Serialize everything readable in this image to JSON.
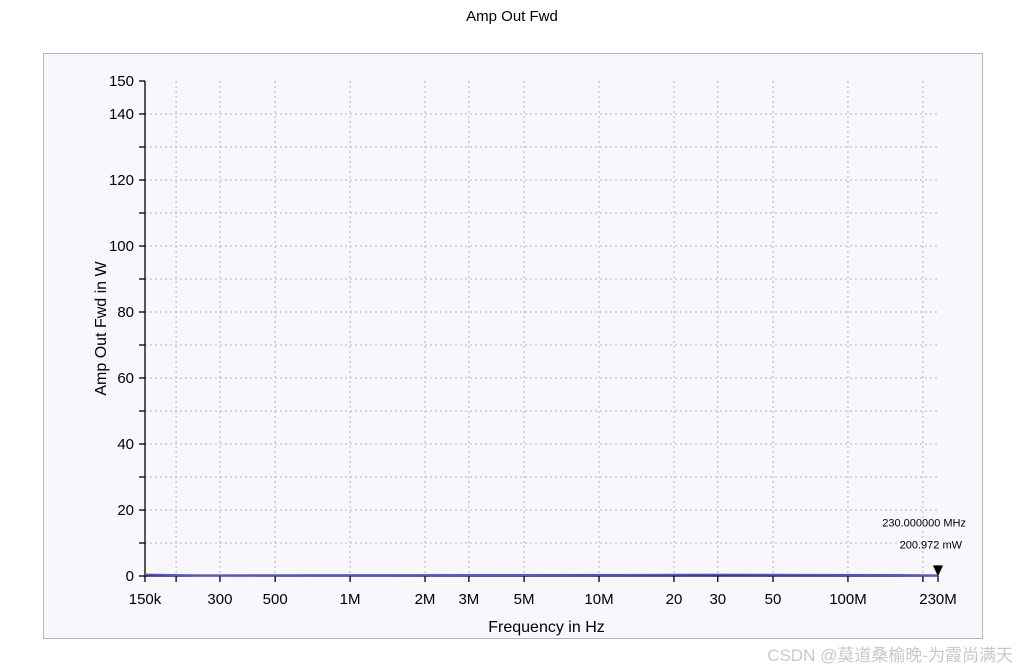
{
  "chart_data": {
    "type": "line",
    "title": "Amp Out Fwd",
    "xlabel": "Frequency in Hz",
    "ylabel": "Amp Out Fwd in W",
    "x_scale": "log",
    "xlim": [
      150000,
      230000000
    ],
    "ylim": [
      0,
      150
    ],
    "x_ticks": [
      {
        "value": 150000,
        "label": "150k"
      },
      {
        "value": 300000,
        "label": "300"
      },
      {
        "value": 500000,
        "label": "500"
      },
      {
        "value": 1000000,
        "label": "1M"
      },
      {
        "value": 2000000,
        "label": "2M"
      },
      {
        "value": 3000000,
        "label": "3M"
      },
      {
        "value": 5000000,
        "label": "5M"
      },
      {
        "value": 10000000,
        "label": "10M"
      },
      {
        "value": 20000000,
        "label": "20"
      },
      {
        "value": 30000000,
        "label": "30"
      },
      {
        "value": 50000000,
        "label": "50"
      },
      {
        "value": 100000000,
        "label": "100M"
      },
      {
        "value": 230000000,
        "label": "230M"
      }
    ],
    "x_grid": [
      150000,
      200000,
      300000,
      500000,
      1000000,
      2000000,
      3000000,
      5000000,
      10000000,
      20000000,
      30000000,
      50000000,
      100000000,
      200000000
    ],
    "y_ticks": [
      {
        "value": 0,
        "label": "0"
      },
      {
        "value": 20,
        "label": "20"
      },
      {
        "value": 40,
        "label": "40"
      },
      {
        "value": 60,
        "label": "60"
      },
      {
        "value": 80,
        "label": "80"
      },
      {
        "value": 100,
        "label": "100"
      },
      {
        "value": 120,
        "label": "120"
      },
      {
        "value": 140,
        "label": "140"
      },
      {
        "value": 150,
        "label": "150"
      }
    ],
    "y_grid": [
      0,
      10,
      20,
      30,
      40,
      50,
      60,
      70,
      80,
      90,
      100,
      110,
      120,
      130,
      140,
      150
    ],
    "grid": true,
    "series": [
      {
        "color": "#5555cc",
        "x": [
          150000,
          250000,
          5000000,
          30000000,
          150000000,
          230000000
        ],
        "y": [
          0.4,
          0.2,
          0.3,
          0.4,
          0.3,
          0.2
        ]
      }
    ],
    "marker": {
      "x": 230000000,
      "y": 0.200972,
      "frequency_label": "230.000000 MHz",
      "value_label": "200.972 mW"
    }
  },
  "watermark": "CSDN @莫道桑榆晚-为霞尚满天"
}
